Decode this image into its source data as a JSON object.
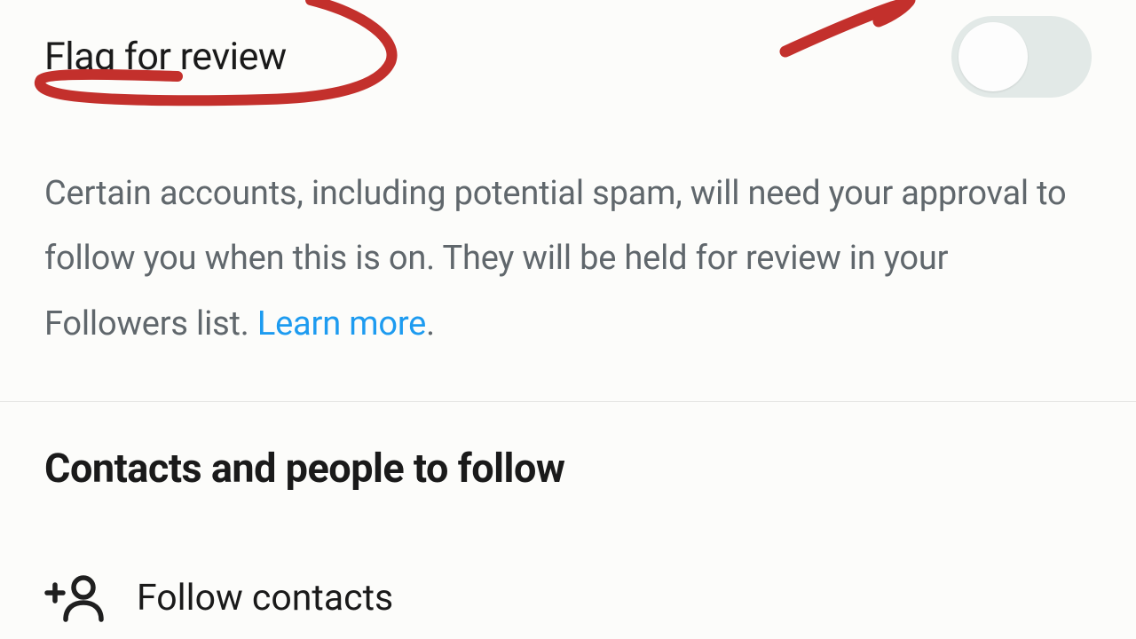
{
  "flag_review": {
    "title": "Flag for review",
    "description_part1": "Certain accounts, including potential spam, will need your approval to follow you when this is on. They will be held for review in your Followers list. ",
    "learn_more": "Learn more",
    "description_trailing": ".",
    "toggle_on": false
  },
  "contacts": {
    "heading": "Contacts and people to follow",
    "follow_label": "Follow contacts"
  },
  "colors": {
    "link": "#1d9bf0",
    "annotation": "#c3302c"
  }
}
